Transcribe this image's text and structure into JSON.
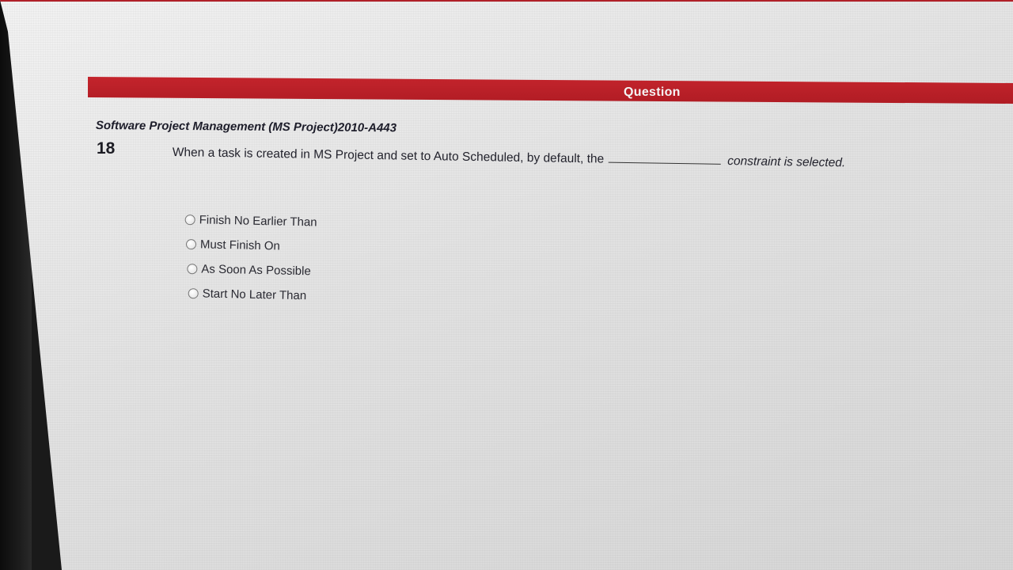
{
  "header": {
    "title": "Question"
  },
  "question": {
    "course": "Software Project Management (MS Project)2010-A443",
    "number": "18",
    "text_before_blank": "When a task is created in MS Project and set to Auto Scheduled, by default, the",
    "text_after_blank": "constraint is selected.",
    "options": [
      {
        "label": "Finish No Earlier Than",
        "selected": false
      },
      {
        "label": "Must Finish On",
        "selected": false
      },
      {
        "label": "As Soon As Possible",
        "selected": false
      },
      {
        "label": "Start No Later Than",
        "selected": false
      }
    ]
  },
  "colors": {
    "header_bar": "#b01c24",
    "header_text": "#f4f4f4",
    "page_background": "#e2e2e2"
  }
}
